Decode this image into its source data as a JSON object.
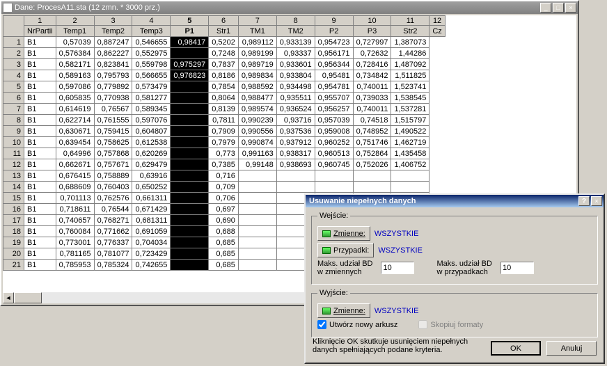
{
  "window": {
    "title": "Dane: ProcesA11.sta (12 zmn. * 3000 prz.)",
    "btn_min": "_",
    "btn_max": "□",
    "btn_close": "×"
  },
  "columns": {
    "nums": [
      "1",
      "2",
      "3",
      "4",
      "5",
      "6",
      "7",
      "8",
      "9",
      "10",
      "11",
      "12"
    ],
    "names": [
      "NrPartii",
      "Temp1",
      "Temp2",
      "Temp3",
      "P1",
      "Str1",
      "TM1",
      "TM2",
      "P2",
      "P3",
      "Str2",
      "Cz"
    ]
  },
  "rows": [
    {
      "n": "1",
      "c": [
        "B1",
        "0,57039",
        "0,887247",
        "0,546655",
        "0,98417",
        "0,5202",
        "0,989112",
        "0,933139",
        "0,954723",
        "0,727997",
        "1,387073"
      ]
    },
    {
      "n": "2",
      "c": [
        "B1",
        "0,576384",
        "0,862227",
        "0,552975",
        "",
        "0,7248",
        "0,989199",
        "0,93337",
        "0,956171",
        "0,72632",
        "1,44286"
      ]
    },
    {
      "n": "3",
      "c": [
        "B1",
        "0,582171",
        "0,823841",
        "0,559798",
        "0,975297",
        "0,7837",
        "0,989719",
        "0,933601",
        "0,956344",
        "0,728416",
        "1,487092"
      ]
    },
    {
      "n": "4",
      "c": [
        "B1",
        "0,589163",
        "0,795793",
        "0,566655",
        "0,976823",
        "0,8186",
        "0,989834",
        "0,933804",
        "0,95481",
        "0,734842",
        "1,511825"
      ]
    },
    {
      "n": "5",
      "c": [
        "B1",
        "0,597086",
        "0,779892",
        "0,573479",
        "",
        "0,7854",
        "0,988592",
        "0,934498",
        "0,954781",
        "0,740011",
        "1,523741"
      ]
    },
    {
      "n": "6",
      "c": [
        "B1",
        "0,605835",
        "0,770938",
        "0,581277",
        "",
        "0,8064",
        "0,988477",
        "0,935511",
        "0,955707",
        "0,739033",
        "1,538545"
      ]
    },
    {
      "n": "7",
      "c": [
        "B1",
        "0,614619",
        "0,76567",
        "0,589345",
        "",
        "0,8139",
        "0,989574",
        "0,936524",
        "0,956257",
        "0,740011",
        "1,537281"
      ]
    },
    {
      "n": "8",
      "c": [
        "B1",
        "0,622714",
        "0,761555",
        "0,597076",
        "",
        "0,7811",
        "0,990239",
        "0,93716",
        "0,957039",
        "0,74518",
        "1,515797"
      ]
    },
    {
      "n": "9",
      "c": [
        "B1",
        "0,630671",
        "0,759415",
        "0,604807",
        "",
        "0,7909",
        "0,990556",
        "0,937536",
        "0,959008",
        "0,748952",
        "1,490522"
      ]
    },
    {
      "n": "10",
      "c": [
        "B1",
        "0,639454",
        "0,758625",
        "0,612538",
        "",
        "0,7979",
        "0,990874",
        "0,937912",
        "0,960252",
        "0,751746",
        "1,462719"
      ]
    },
    {
      "n": "11",
      "c": [
        "B1",
        "0,64996",
        "0,757868",
        "0,620269",
        "",
        "0,773",
        "0,991163",
        "0,938317",
        "0,960513",
        "0,752864",
        "1,435458"
      ]
    },
    {
      "n": "12",
      "c": [
        "B1",
        "0,662671",
        "0,757671",
        "0,629479",
        "",
        "0,7385",
        "0,99148",
        "0,938693",
        "0,960745",
        "0,752026",
        "1,406752"
      ]
    },
    {
      "n": "13",
      "c": [
        "B1",
        "0,676415",
        "0,758889",
        "0,63916",
        "",
        "0,716",
        "",
        "",
        "",
        "",
        ""
      ]
    },
    {
      "n": "14",
      "c": [
        "B1",
        "0,688609",
        "0,760403",
        "0,650252",
        "",
        "0,709",
        "",
        "",
        "",
        "",
        ""
      ]
    },
    {
      "n": "15",
      "c": [
        "B1",
        "0,701113",
        "0,762576",
        "0,661311",
        "",
        "0,706",
        "",
        "",
        "",
        "",
        ""
      ]
    },
    {
      "n": "16",
      "c": [
        "B1",
        "0,718611",
        "0,76544",
        "0,671429",
        "",
        "0,697",
        "",
        "",
        "",
        "",
        ""
      ]
    },
    {
      "n": "17",
      "c": [
        "B1",
        "0,740657",
        "0,768271",
        "0,681311",
        "",
        "0,690",
        "",
        "",
        "",
        "",
        ""
      ]
    },
    {
      "n": "18",
      "c": [
        "B1",
        "0,760084",
        "0,771662",
        "0,691059",
        "",
        "0,688",
        "",
        "",
        "",
        "",
        ""
      ]
    },
    {
      "n": "19",
      "c": [
        "B1",
        "0,773001",
        "0,776337",
        "0,704034",
        "",
        "0,685",
        "",
        "",
        "",
        "",
        ""
      ]
    },
    {
      "n": "20",
      "c": [
        "B1",
        "0,781165",
        "0,781077",
        "0,723429",
        "",
        "0,685",
        "",
        "",
        "",
        "",
        ""
      ]
    },
    {
      "n": "21",
      "c": [
        "B1",
        "0,785953",
        "0,785324",
        "0,742655",
        "",
        "0,685",
        "",
        "",
        "",
        "",
        ""
      ]
    }
  ],
  "sel_col_index": 4,
  "dialog": {
    "title": "Usuwanie niepełnych danych",
    "help": "?",
    "close": "×",
    "in_legend": "Wejście:",
    "btn_vars": "Zmienne:",
    "btn_cases": "Przypadki:",
    "val_vars": "WSZYSTKIE",
    "val_cases": "WSZYSTKIE",
    "max_bd_vars_lbl1": "Maks. udział BD",
    "max_bd_vars_lbl2": "w zmiennych",
    "max_bd_vars_val": "10",
    "max_bd_cases_lbl1": "Maks. udział BD",
    "max_bd_cases_lbl2": "w przypadkach",
    "max_bd_cases_val": "10",
    "out_legend": "Wyjście:",
    "out_btn_vars": "Zmienne:",
    "out_val_vars": "WSZYSTKIE",
    "chk_new_sheet": "Utwórz nowy arkusz",
    "chk_copy_fmt": "Skopiuj formaty",
    "note": "Kliknięcie OK skutkuje usunięciem niepełnych danych spełniających podane kryteria.",
    "ok": "OK",
    "cancel": "Anuluj"
  }
}
